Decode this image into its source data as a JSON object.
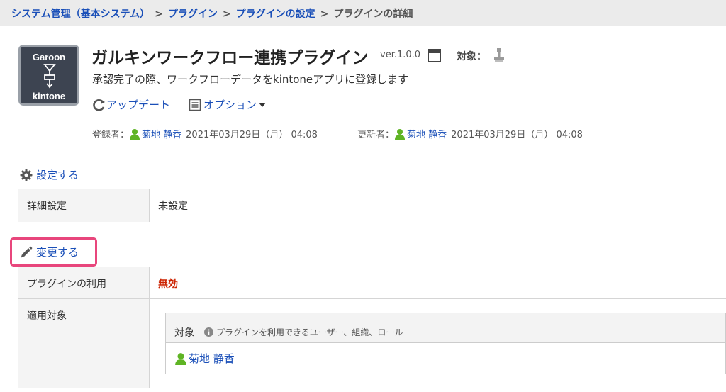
{
  "breadcrumb": {
    "items": [
      "システム管理（基本システム）",
      "プラグイン",
      "プラグインの設定"
    ],
    "separator": ">",
    "current": "プラグインの詳細"
  },
  "plugin": {
    "logo_top": "Garoon",
    "logo_bottom": "kintone",
    "title": "ガルキンワークフロー連携プラグイン",
    "version": "ver.1.0.0",
    "target_label": "対象：",
    "description": "承認完了の際、ワークフローデータをkintoneアプリに登録します",
    "update_label": "アップデート",
    "option_label": "オプション"
  },
  "meta": {
    "registered_label": "登録者：",
    "registered_user": "菊地 静香",
    "registered_date": "2021年03月29日（月） 04:08",
    "updated_label": "更新者：",
    "updated_user": "菊地 静香",
    "updated_date": "2021年03月29日（月） 04:08"
  },
  "settings": {
    "link_label": "設定する",
    "row_label": "詳細設定",
    "row_value": "未設定"
  },
  "change": {
    "link_label": "変更する",
    "usage_label": "プラグインの利用",
    "usage_value": "無効",
    "scope_label": "適用対象",
    "target_header": "対象",
    "target_note": "プラグインを利用できるユーザー、組織、ロール",
    "target_user": "菊地 静香"
  },
  "colors": {
    "link": "#1a4fb8",
    "disabled": "#cc2200",
    "highlight": "#e8467c",
    "user_icon": "#5fb424"
  }
}
